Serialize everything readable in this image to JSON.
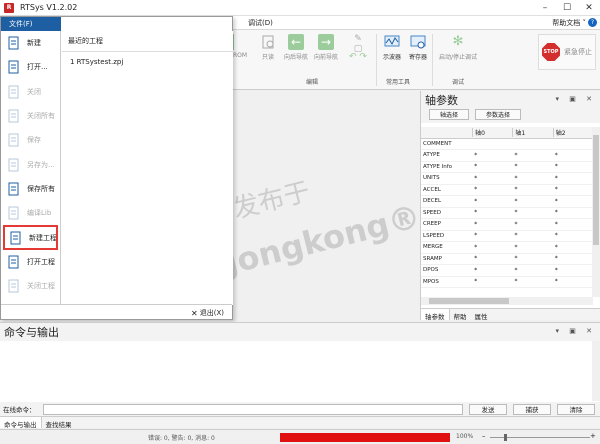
{
  "window": {
    "title": "RTSys V1.2.02"
  },
  "menubar": {
    "debug": "调试(D)",
    "help_doc": "帮助文档",
    "help_symbol": "?"
  },
  "ribbon": {
    "partial_button": "ROM",
    "nav_buttons": [
      "只读",
      "向后导航",
      "向前导航"
    ],
    "edit_group_label": "编辑",
    "tool_buttons": [
      "示波器",
      "寄存器"
    ],
    "tools_group_label": "常用工具",
    "debug_button": "启动/停止调试",
    "debug_group_label": "调试",
    "stop_icon": "STOP",
    "stop_label": "紧急停止"
  },
  "file_menu": {
    "tab_label": "文件(F)",
    "items": [
      {
        "label": "新建",
        "icon": "new-icon",
        "enabled": true
      },
      {
        "label": "打开...",
        "icon": "open-folder-icon",
        "enabled": true
      },
      {
        "label": "关闭",
        "icon": "close-file-icon",
        "enabled": false
      },
      {
        "label": "关闭所有",
        "icon": "close-all-icon",
        "enabled": false
      },
      {
        "label": "保存",
        "icon": "save-icon",
        "enabled": false
      },
      {
        "label": "另存为...",
        "icon": "save-as-icon",
        "enabled": false
      },
      {
        "label": "保存所有",
        "icon": "save-all-icon",
        "enabled": true
      },
      {
        "label": "编译Lib",
        "icon": "compile-lib-icon",
        "enabled": false
      },
      {
        "label": "新建工程",
        "icon": "new-project-icon",
        "enabled": true,
        "highlighted": true
      },
      {
        "label": "打开工程",
        "icon": "open-project-icon",
        "enabled": true
      },
      {
        "label": "关闭工程",
        "icon": "close-project-icon",
        "enabled": false
      }
    ],
    "recent_title": "最近的工程",
    "recent_items": [
      "1 RTSystest.zpj"
    ],
    "exit_label": "退出(X)"
  },
  "axis_panel": {
    "title": "轴参数",
    "axis_select": "轴选择",
    "param_select": "参数选择",
    "columns": [
      "轴0",
      "轴1",
      "轴2"
    ],
    "rows": [
      {
        "name": "COMMENT",
        "values": [
          "",
          "",
          ""
        ]
      },
      {
        "name": "ATYPE",
        "values": [
          "*",
          "*",
          "*"
        ]
      },
      {
        "name": "ATYPE Info",
        "values": [
          "*",
          "*",
          "*"
        ]
      },
      {
        "name": "UNITS",
        "values": [
          "*",
          "*",
          "*"
        ]
      },
      {
        "name": "ACCEL",
        "values": [
          "*",
          "*",
          "*"
        ]
      },
      {
        "name": "DECEL",
        "values": [
          "*",
          "*",
          "*"
        ]
      },
      {
        "name": "SPEED",
        "values": [
          "*",
          "*",
          "*"
        ]
      },
      {
        "name": "CREEP",
        "values": [
          "*",
          "*",
          "*"
        ]
      },
      {
        "name": "LSPEED",
        "values": [
          "*",
          "*",
          "*"
        ]
      },
      {
        "name": "MERGE",
        "values": [
          "*",
          "*",
          "*"
        ]
      },
      {
        "name": "SRAMP",
        "values": [
          "*",
          "*",
          "*"
        ]
      },
      {
        "name": "DPOS",
        "values": [
          "*",
          "*",
          "*"
        ]
      },
      {
        "name": "MPOS",
        "values": [
          "*",
          "*",
          "*"
        ]
      }
    ],
    "tabs": [
      "轴参数",
      "帮助",
      "属性"
    ]
  },
  "command_panel": {
    "title": "命令与输出",
    "online_cmd_label": "在线命令：",
    "send": "发送",
    "capture": "捕获",
    "clear": "清除",
    "tabs": [
      "命令与输出",
      "查找结果"
    ]
  },
  "status": {
    "text": "错误: 0, 警告: 0, 消息: 0",
    "progress_fraction": 1.0,
    "zoom": "100%"
  },
  "watermark": {
    "line1": "发布于",
    "line2": "gongkong®"
  },
  "colors": {
    "accent_blue": "#1e5fa3",
    "highlight_red": "#e53935",
    "progress_red": "#e01010"
  }
}
